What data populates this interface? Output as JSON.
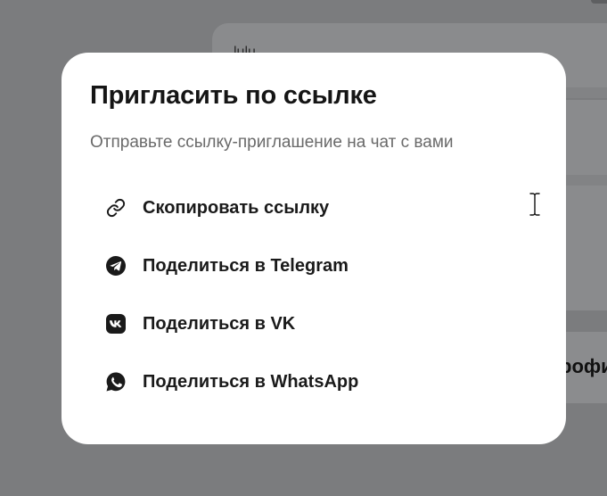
{
  "background": {
    "top_text": "lulu",
    "right_text": "рофи"
  },
  "modal": {
    "title": "Пригласить по ссылке",
    "subtitle": "Отправьте ссылку-приглашение на чат с вами",
    "options": [
      {
        "icon": "link-icon",
        "label": "Скопировать ссылку"
      },
      {
        "icon": "telegram-icon",
        "label": "Поделиться в Telegram"
      },
      {
        "icon": "vk-icon",
        "label": "Поделиться в VK"
      },
      {
        "icon": "whatsapp-icon",
        "label": "Поделиться в WhatsApp"
      }
    ]
  },
  "colors": {
    "overlay": "#7b7c7e",
    "modal_background": "#ffffff",
    "title_text": "#151515",
    "subtitle_text": "#6a6a6a"
  }
}
